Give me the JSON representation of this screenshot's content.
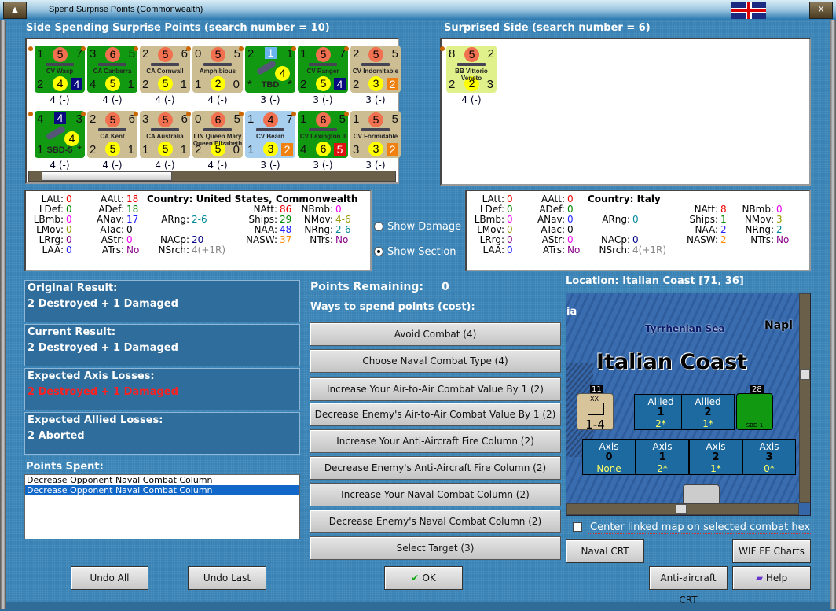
{
  "window": {
    "title": "Spend Surprise Points (Commonwealth)",
    "minimize": "▲",
    "close": "X"
  },
  "spending": {
    "header": "Side Spending Surprise Points (search number = 10)",
    "units": [
      {
        "name": "CV Wasp",
        "tl": "1",
        "tc": "5",
        "tr": "7",
        "bl": "2",
        "bc": "4",
        "br": "4",
        "bg": "#119a11",
        "box": "#0a0a80",
        "label": "4 (-)"
      },
      {
        "name": "CA Canberra",
        "tl": "3",
        "tc": "6",
        "tr": "5",
        "bl": "4",
        "bc": "5",
        "br": "1",
        "bg": "#119a11",
        "box": "",
        "label": "4 (-)"
      },
      {
        "name": "CA Cornwall",
        "tl": "2",
        "tc": "5",
        "tr": "6",
        "bl": "2",
        "bc": "5",
        "br": "1",
        "bg": "#cdbd93",
        "box": "",
        "label": "4 (-)"
      },
      {
        "name": "Amphibious",
        "tl": "0",
        "tc": "5",
        "tr": "5",
        "bl": "1",
        "bc": "2",
        "br": "0",
        "bg": "#cdbd93",
        "box": "",
        "label": "4 (-)"
      },
      {
        "name": "TBD",
        "tl": "2",
        "tc": "1",
        "tr": "1",
        "bl": "*",
        "bc": "4",
        "br": "*",
        "bg": "#119a11",
        "box": "",
        "label": "3 (-)",
        "air": true
      },
      {
        "name": "CV Ranger",
        "tl": "1",
        "tc": "5",
        "tr": "7",
        "bl": "2",
        "bc": "5",
        "br": "4",
        "bg": "#119a11",
        "box": "#0a0a80",
        "label": "3 (-)"
      },
      {
        "name": "CV Indomitable",
        "tl": "2",
        "tc": "5",
        "tr": "5",
        "bl": "2",
        "bc": "3",
        "br": "2",
        "bg": "#cdbd93",
        "box": "#f08010",
        "label": "3 (-)"
      },
      {
        "name": "SBD-5",
        "tl": "4",
        "tc": "4",
        "tr": "3",
        "bl": "1",
        "bc": "4",
        "br": "*",
        "bg": "#119a11",
        "box": "",
        "label": "4 (-)",
        "air": true
      },
      {
        "name": "CA Kent",
        "tl": "2",
        "tc": "5",
        "tr": "6",
        "bl": "2",
        "bc": "5",
        "br": "1",
        "bg": "#cdbd93",
        "box": "",
        "label": "4 (-)"
      },
      {
        "name": "CA Australia",
        "tl": "3",
        "tc": "5",
        "tr": "6",
        "bl": "1",
        "bc": "5",
        "br": "1",
        "bg": "#cdbd93",
        "box": "",
        "label": "4 (-)"
      },
      {
        "name": "LIN Queen Mary Queen Elizabeth",
        "tl": "0",
        "tc": "6",
        "tr": "5",
        "bl": "2",
        "bc": "5",
        "br": "0",
        "bg": "#cdbd93",
        "box": "",
        "label": "4 (-)"
      },
      {
        "name": "CV Bearn",
        "tl": "1",
        "tc": "4",
        "tr": "7",
        "bl": "1",
        "bc": "3",
        "br": "2",
        "bg": "#a8d0ee",
        "box": "#f08010",
        "label": "3 (-)"
      },
      {
        "name": "CV Lexington II",
        "tl": "1",
        "tc": "6",
        "tr": "5",
        "bl": "4",
        "bc": "6",
        "br": "5",
        "bg": "#119a11",
        "box": "#e01010",
        "label": "3 (-)"
      },
      {
        "name": "CV Formidable",
        "tl": "1",
        "tc": "5",
        "tr": "5",
        "bl": "3",
        "bc": "3",
        "br": "2",
        "bg": "#cdbd93",
        "box": "#f08010",
        "label": "3 (-)"
      }
    ],
    "stats": {
      "country": "Country: United States, Commonwealth",
      "items": [
        {
          "k": "LAtt:",
          "v": "0",
          "c": "#e00"
        },
        {
          "k": "AAtt:",
          "v": "18",
          "c": "#e00"
        },
        {
          "k": "LDef:",
          "v": "0",
          "c": "#080"
        },
        {
          "k": "ADef:",
          "v": "18",
          "c": "#080"
        },
        {
          "k": "NAtt:",
          "v": "86",
          "c": "#e00"
        },
        {
          "k": "NBmb:",
          "v": "0",
          "c": "#e0e"
        },
        {
          "k": "LBmb:",
          "v": "0",
          "c": "#e0e"
        },
        {
          "k": "ANav:",
          "v": "17",
          "c": "#22f"
        },
        {
          "k": "ARng:",
          "v": "2-6",
          "c": "#089"
        },
        {
          "k": "Ships:",
          "v": "29",
          "c": "#080"
        },
        {
          "k": "NMov:",
          "v": "4-6",
          "c": "#990"
        },
        {
          "k": "LMov:",
          "v": "0",
          "c": "#990"
        },
        {
          "k": "ATac:",
          "v": "0",
          "c": "#000"
        },
        {
          "k": "NAA:",
          "v": "48",
          "c": "#22f"
        },
        {
          "k": "NRng:",
          "v": "2-6",
          "c": "#089"
        },
        {
          "k": "LRrg:",
          "v": "0",
          "c": "#808"
        },
        {
          "k": "AStr:",
          "v": "0",
          "c": "#e0e"
        },
        {
          "k": "NACp:",
          "v": "20",
          "c": "#008"
        },
        {
          "k": "NASW:",
          "v": "37",
          "c": "#f80"
        },
        {
          "k": "NTrs:",
          "v": "No",
          "c": "#808"
        },
        {
          "k": "LAA:",
          "v": "0",
          "c": "#22f"
        },
        {
          "k": "ATrs:",
          "v": "No",
          "c": "#808"
        },
        {
          "k": "NSrch:",
          "v": "4(+1R)",
          "c": "#888"
        }
      ]
    }
  },
  "surprised": {
    "header": "Surprised Side (search number = 6)",
    "units": [
      {
        "name": "BB Vittorio Veneto",
        "tl": "8",
        "tc": "5",
        "tr": "2",
        "bl": "2",
        "bc": "2",
        "br": "3",
        "bg": "#e0f08a",
        "box": "",
        "label": "4 (-)"
      }
    ],
    "stats": {
      "country": "Country: Italy",
      "items": [
        {
          "k": "LAtt:",
          "v": "0",
          "c": "#e00"
        },
        {
          "k": "AAtt:",
          "v": "0",
          "c": "#e00"
        },
        {
          "k": "LDef:",
          "v": "0",
          "c": "#080"
        },
        {
          "k": "ADef:",
          "v": "0",
          "c": "#080"
        },
        {
          "k": "NAtt:",
          "v": "8",
          "c": "#e00"
        },
        {
          "k": "NBmb:",
          "v": "0",
          "c": "#e0e"
        },
        {
          "k": "LBmb:",
          "v": "0",
          "c": "#e0e"
        },
        {
          "k": "ANav:",
          "v": "0",
          "c": "#22f"
        },
        {
          "k": "ARng:",
          "v": "0",
          "c": "#089"
        },
        {
          "k": "Ships:",
          "v": "1",
          "c": "#080"
        },
        {
          "k": "NMov:",
          "v": "3",
          "c": "#990"
        },
        {
          "k": "LMov:",
          "v": "0",
          "c": "#990"
        },
        {
          "k": "ATac:",
          "v": "0",
          "c": "#000"
        },
        {
          "k": "NAA:",
          "v": "2",
          "c": "#22f"
        },
        {
          "k": "NRng:",
          "v": "2",
          "c": "#089"
        },
        {
          "k": "LRrg:",
          "v": "0",
          "c": "#808"
        },
        {
          "k": "AStr:",
          "v": "0",
          "c": "#e0e"
        },
        {
          "k": "NACp:",
          "v": "0",
          "c": "#008"
        },
        {
          "k": "NASW:",
          "v": "2",
          "c": "#f80"
        },
        {
          "k": "NTrs:",
          "v": "No",
          "c": "#808"
        },
        {
          "k": "LAA:",
          "v": "0",
          "c": "#22f"
        },
        {
          "k": "ATrs:",
          "v": "No",
          "c": "#808"
        },
        {
          "k": "NSrch:",
          "v": "4(+1R)",
          "c": "#888"
        }
      ]
    }
  },
  "view": {
    "show_damage": "Show Damage",
    "show_section": "Show Section",
    "selected": "show_section"
  },
  "results": [
    {
      "h": "Original Result:",
      "v": "2 Destroyed + 1 Damaged",
      "c": "#fff"
    },
    {
      "h": "Current Result:",
      "v": "2 Destroyed + 1 Damaged",
      "c": "#fff"
    },
    {
      "h": "Expected Axis Losses:",
      "v": "2 Destroyed + 1 Damaged",
      "c": "#ff2020"
    },
    {
      "h": "Expected Allied Losses:",
      "v": "2 Aborted",
      "c": "#fff"
    }
  ],
  "points_spent": {
    "label": "Points Spent:",
    "items": [
      "Decrease Opponent Naval Combat Column",
      "Decrease Opponent Naval Combat Column"
    ],
    "selected": 1
  },
  "spend": {
    "remaining_label": "Points Remaining:",
    "remaining": "0",
    "ways_label": "Ways to spend points (cost):",
    "options": [
      "Avoid Combat (4)",
      "Choose Naval Combat Type (4)",
      "Increase Your Air-to-Air Combat Value By 1 (2)",
      "Decrease Enemy's Air-to-Air Combat Value By 1 (2)",
      "Increase Your Anti-Aircraft Fire Column (2)",
      "Decrease Enemy's Anti-Aircraft Fire Column (2)",
      "Increase Your Naval Combat Column (2)",
      "Decrease Enemy's Naval Combat Column (2)",
      "Select Target (3)"
    ]
  },
  "map": {
    "location": "Location: Italian Coast [71, 36]",
    "sea": "Tyrrhenian Sea",
    "area": "Italian Coast",
    "frag_left": "ia",
    "frag_right": "Napl",
    "stack1": "11",
    "unit_div": "1-4",
    "unit_div_type": "XX",
    "stack2": "28",
    "air_unit": "SBD-1",
    "allied": [
      {
        "t": "Allied",
        "n": "1",
        "v": "2*"
      },
      {
        "t": "Allied",
        "n": "2",
        "v": "1*"
      }
    ],
    "axis": [
      {
        "t": "Axis",
        "n": "0",
        "v": "None"
      },
      {
        "t": "Axis",
        "n": "1",
        "v": "2*"
      },
      {
        "t": "Axis",
        "n": "2",
        "v": "1*"
      },
      {
        "t": "Axis",
        "n": "3",
        "v": "0*"
      }
    ],
    "center_label": "Center linked map on selected combat hex"
  },
  "buttons": {
    "naval_crt": "Naval CRT",
    "wif_charts": "WIF FE Charts",
    "aa_crt": "Anti-aircraft CRT",
    "help": "Help",
    "undo_all": "Undo All",
    "undo_last": "Undo Last",
    "ok": "OK"
  }
}
